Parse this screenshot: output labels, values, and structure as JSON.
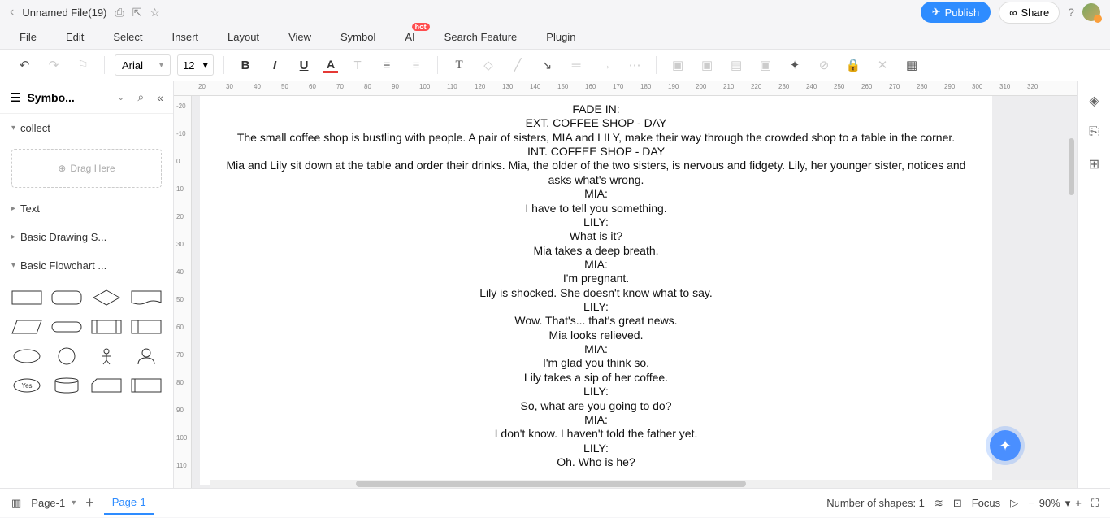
{
  "title": {
    "filename": "Unnamed File(19)"
  },
  "header": {
    "publish": "Publish",
    "share": "Share"
  },
  "menu": {
    "file": "File",
    "edit": "Edit",
    "select": "Select",
    "insert": "Insert",
    "layout": "Layout",
    "view": "View",
    "symbol": "Symbol",
    "ai": "AI",
    "ai_badge": "hot",
    "search": "Search Feature",
    "plugin": "Plugin"
  },
  "toolbar": {
    "font": "Arial",
    "size": "12"
  },
  "sidebar": {
    "title": "Symbo...",
    "sections": {
      "collect": "collect",
      "text": "Text",
      "basic_drawing": "Basic Drawing S...",
      "basic_flowchart": "Basic Flowchart ..."
    },
    "drag": "Drag Here",
    "yes": "Yes"
  },
  "ruler_h": [
    "20",
    "30",
    "40",
    "50",
    "60",
    "70",
    "80",
    "90",
    "100",
    "110",
    "120",
    "130",
    "140",
    "150",
    "160",
    "170",
    "180",
    "190",
    "200",
    "210",
    "220",
    "230",
    "240",
    "250",
    "260",
    "270",
    "280",
    "290",
    "300",
    "310",
    "320"
  ],
  "ruler_v": [
    "-20",
    "-10",
    "0",
    "10",
    "20",
    "30",
    "40",
    "50",
    "60",
    "70",
    "80",
    "90",
    "100",
    "110"
  ],
  "doc": {
    "l1": "FADE IN:",
    "l2": "EXT. COFFEE SHOP - DAY",
    "l3": "The small coffee shop is bustling with people. A pair of sisters, MIA and LILY, make their way through the crowded shop to a table in the corner.",
    "l4": "INT. COFFEE SHOP - DAY",
    "l5": "Mia and Lily sit down at the table and order their drinks. Mia, the older of the two sisters, is nervous and fidgety. Lily, her younger sister, notices and asks what's wrong.",
    "l6": "MIA:",
    "l7": "I have to tell you something.",
    "l8": "LILY:",
    "l9": "What is it?",
    "l10": "Mia takes a deep breath.",
    "l11": "MIA:",
    "l12": "I'm pregnant.",
    "l13": "Lily is shocked. She doesn't know what to say.",
    "l14": "LILY:",
    "l15": "Wow. That's... that's great news.",
    "l16": "Mia looks relieved.",
    "l17": "MIA:",
    "l18": "I'm glad you think so.",
    "l19": "Lily takes a sip of her coffee.",
    "l20": "LILY:",
    "l21": "So, what are you going to do?",
    "l22": "MIA:",
    "l23": "I don't know. I haven't told the father yet.",
    "l24": "LILY:",
    "l25": "Oh. Who is he?"
  },
  "status": {
    "page_sel": "Page-1",
    "tab": "Page-1",
    "shapes": "Number of shapes: 1",
    "focus": "Focus",
    "zoom": "90%"
  }
}
